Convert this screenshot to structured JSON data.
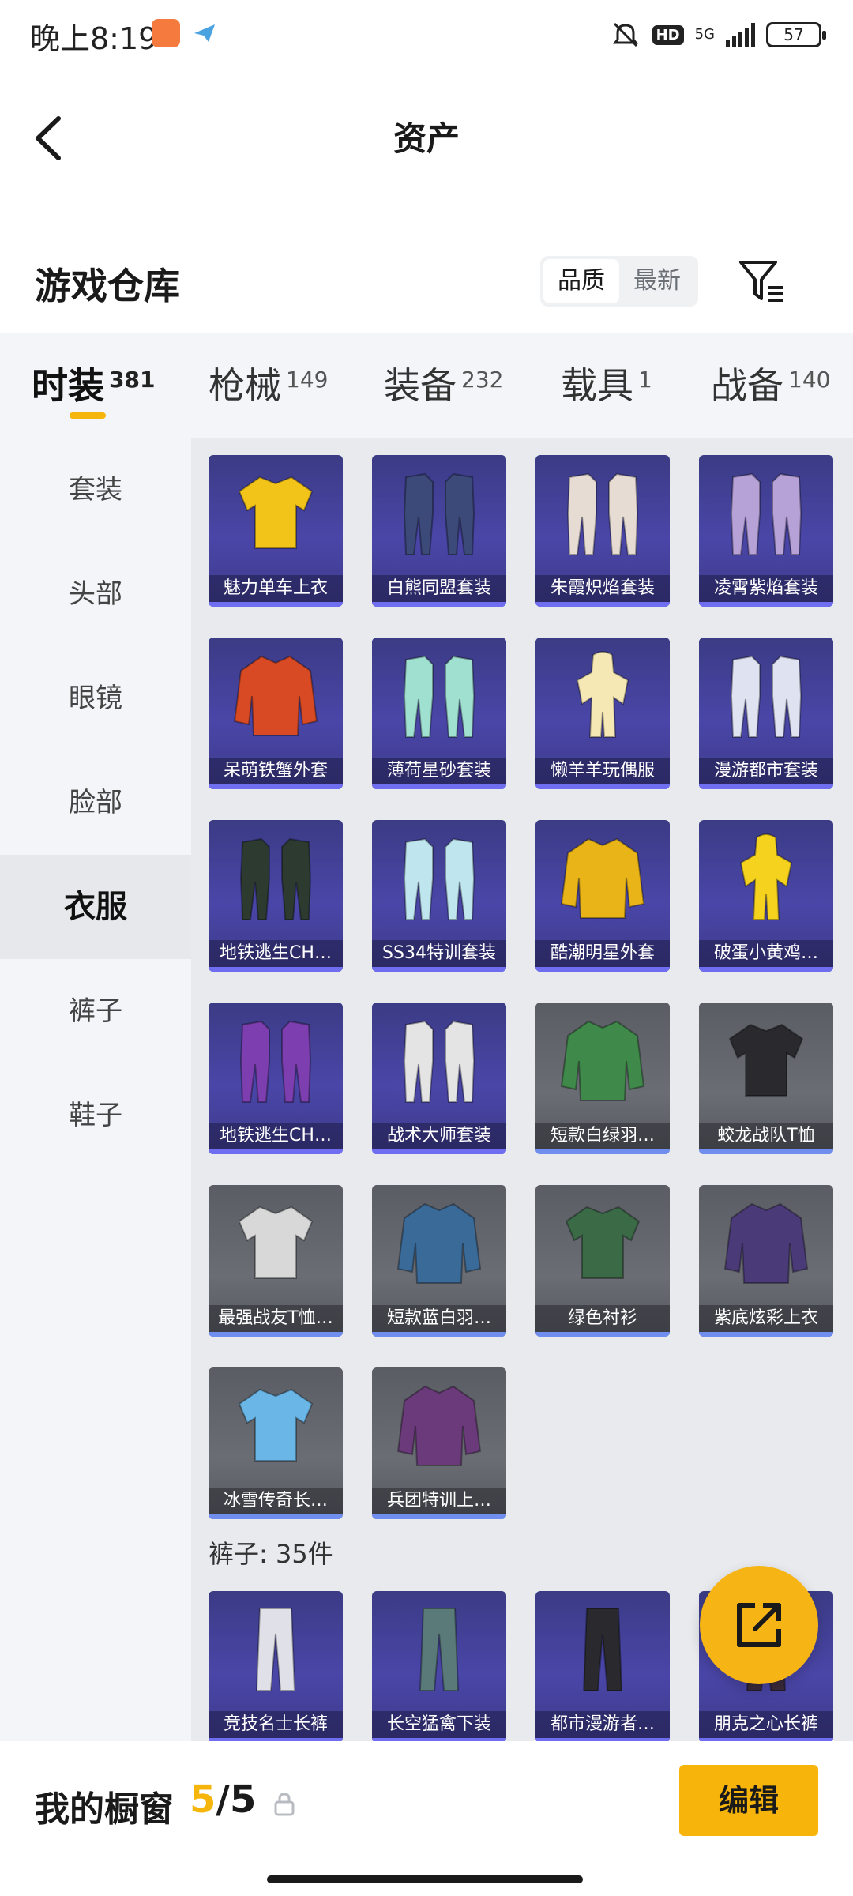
{
  "status_bar": {
    "time": "晚上8:19",
    "network": "5G",
    "hd": "HD",
    "battery": "57"
  },
  "header": {
    "title": "资产"
  },
  "warehouse": {
    "title": "游戏仓库",
    "sort_options": [
      "品质",
      "最新"
    ],
    "sort_selected": "品质"
  },
  "tabs": [
    {
      "label": "时装",
      "count": "381",
      "active": true
    },
    {
      "label": "枪械",
      "count": "149"
    },
    {
      "label": "装备",
      "count": "232"
    },
    {
      "label": "载具",
      "count": "1"
    },
    {
      "label": "战备",
      "count": "140"
    }
  ],
  "sidebar": {
    "items": [
      {
        "label": "套装"
      },
      {
        "label": "头部"
      },
      {
        "label": "眼镜"
      },
      {
        "label": "脸部"
      },
      {
        "label": "衣服",
        "active": true
      },
      {
        "label": "裤子"
      },
      {
        "label": "鞋子"
      }
    ]
  },
  "clothes": [
    {
      "name": "魅力单车上衣",
      "tier": "purple",
      "icon": "shirt-icon",
      "color": "#f2c318"
    },
    {
      "name": "白熊同盟套装",
      "tier": "purple",
      "icon": "outfit-icon",
      "color": "#3c4a7a"
    },
    {
      "name": "朱霞炽焰套装",
      "tier": "purple",
      "icon": "outfit-icon",
      "color": "#e6dcd4"
    },
    {
      "name": "凌霄紫焰套装",
      "tier": "purple",
      "icon": "outfit-icon",
      "color": "#b7a2d8"
    },
    {
      "name": "呆萌铁蟹外套",
      "tier": "purple",
      "icon": "jacket-icon",
      "color": "#d84a24"
    },
    {
      "name": "薄荷星砂套装",
      "tier": "purple",
      "icon": "outfit-icon",
      "color": "#9fe0d0"
    },
    {
      "name": "懒羊羊玩偶服",
      "tier": "purple",
      "icon": "costume-icon",
      "color": "#f6e8b4"
    },
    {
      "name": "漫游都市套装",
      "tier": "purple",
      "icon": "outfit-icon",
      "color": "#dfe2f0"
    },
    {
      "name": "地铁逃生CH…",
      "tier": "purple",
      "icon": "outfit-icon",
      "color": "#2c3a30"
    },
    {
      "name": "SS34特训套装",
      "tier": "purple",
      "icon": "outfit-icon",
      "color": "#bfe6ee"
    },
    {
      "name": "酷潮明星外套",
      "tier": "purple",
      "icon": "jacket-icon",
      "color": "#e8b418"
    },
    {
      "name": "破蛋小黄鸡…",
      "tier": "purple",
      "icon": "costume-icon",
      "color": "#f4d21e"
    },
    {
      "name": "地铁逃生CH…",
      "tier": "purple",
      "icon": "outfit-icon",
      "color": "#7d3fb0"
    },
    {
      "name": "战术大师套装",
      "tier": "purple",
      "icon": "outfit-icon",
      "color": "#e4e4e4"
    },
    {
      "name": "短款白绿羽…",
      "tier": "grey",
      "icon": "jacket-icon",
      "color": "#3f8a4a"
    },
    {
      "name": "蛟龙战队T恤",
      "tier": "grey",
      "icon": "shirt-icon",
      "color": "#2a2a2e"
    },
    {
      "name": "最强战友T恤…",
      "tier": "grey",
      "icon": "shirt-icon",
      "color": "#d8d8d8"
    },
    {
      "name": "短款蓝白羽…",
      "tier": "grey",
      "icon": "jacket-icon",
      "color": "#3a6a98"
    },
    {
      "name": "绿色衬衫",
      "tier": "grey",
      "icon": "shirt-icon",
      "color": "#3a6a46"
    },
    {
      "name": "紫底炫彩上衣",
      "tier": "grey",
      "icon": "jacket-icon",
      "color": "#4a3a78"
    },
    {
      "name": "冰雪传奇长…",
      "tier": "grey",
      "icon": "shirt-icon",
      "color": "#6ab6e6"
    },
    {
      "name": "兵团特训上…",
      "tier": "grey",
      "icon": "jacket-icon",
      "color": "#6a3a7a"
    }
  ],
  "pants_section": {
    "heading": "裤子: 35件",
    "items": [
      {
        "name": "竞技名士长裤",
        "tier": "purple",
        "icon": "pants-icon",
        "color": "#e0e0e8"
      },
      {
        "name": "长空猛禽下装",
        "tier": "purple",
        "icon": "pants-icon",
        "color": "#5a7a7a"
      },
      {
        "name": "都市漫游者…",
        "tier": "purple",
        "icon": "pants-icon",
        "color": "#2a2a2e"
      },
      {
        "name": "朋克之心长裤",
        "tier": "purple",
        "icon": "pants-icon",
        "color": "#3a2a3a"
      }
    ]
  },
  "fab": {
    "icon": "share-icon"
  },
  "bottom_bar": {
    "label": "我的橱窗",
    "current": "5",
    "separator": "/",
    "total": "5",
    "edit_label": "编辑"
  },
  "colors": {
    "accent": "#f5b50a",
    "purple_tier": "#4a46a8",
    "grey_tier": "#62656c"
  }
}
